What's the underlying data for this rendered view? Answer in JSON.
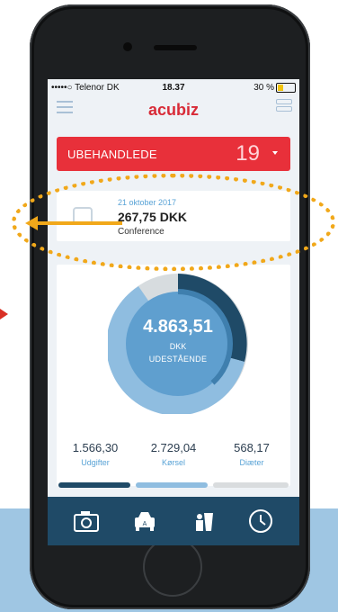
{
  "status_bar": {
    "carrier": "•••••○ Telenor DK",
    "time": "18.37",
    "battery": "30 %"
  },
  "app": {
    "logo": "acubiz"
  },
  "unhandled": {
    "label": "UBEHANDLEDE",
    "count": "19"
  },
  "expense": {
    "date": "21 oktober 2017",
    "amount": "267,75 DKK",
    "description": "Conference",
    "icon": "car-icon"
  },
  "summary": {
    "value": "4.863,51",
    "currency": "DKK",
    "status": "UDESTÅENDE",
    "stats": [
      {
        "value": "1.566,30",
        "label": "Udgifter"
      },
      {
        "value": "2.729,04",
        "label": "Kørsel"
      },
      {
        "value": "568,17",
        "label": "Diæter"
      }
    ]
  },
  "tabs": [
    {
      "icon": "camera-icon"
    },
    {
      "icon": "car-icon"
    },
    {
      "icon": "food-drink-icon"
    },
    {
      "icon": "clock-icon"
    }
  ],
  "colors": {
    "accent": "#d82b37",
    "banner": "#e8303a",
    "annotation": "#f1a81a",
    "udgifter": "#1f4a67",
    "korsel": "#8fbde0",
    "diaeter": "#d9dcde"
  }
}
